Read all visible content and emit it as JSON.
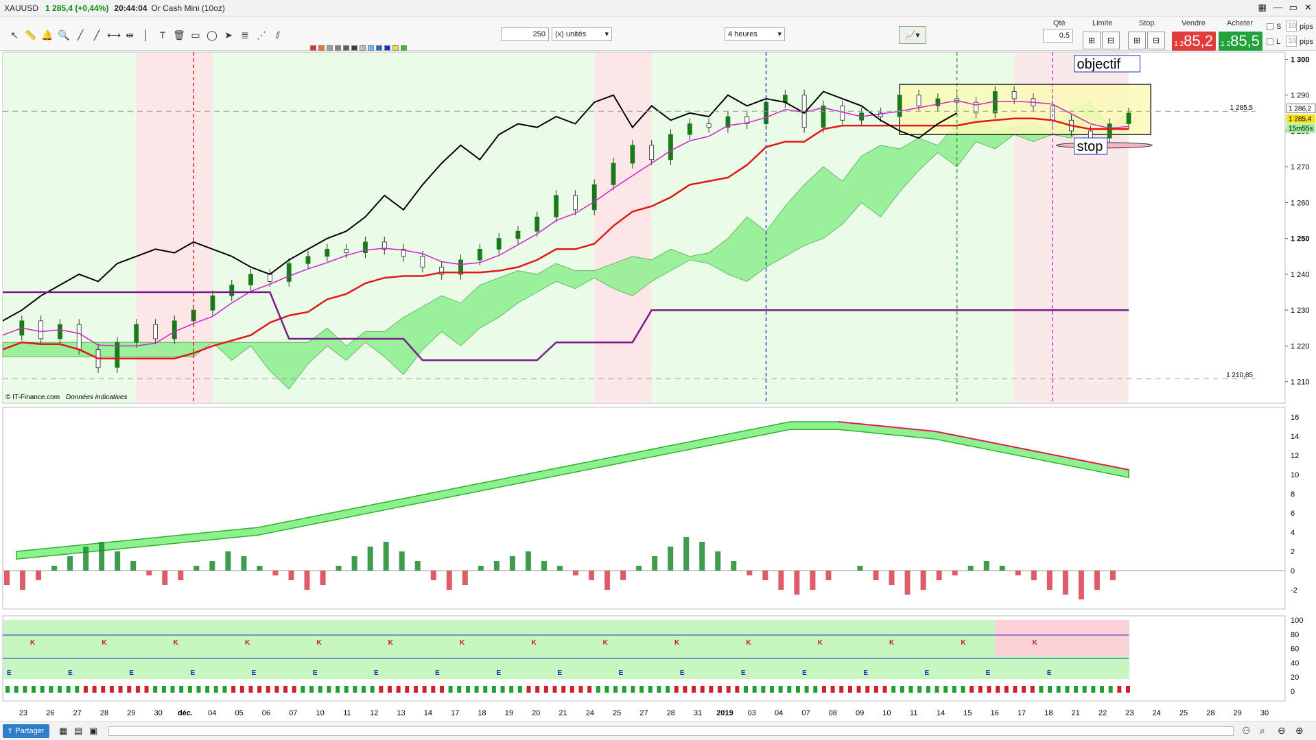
{
  "window": {
    "symbol": "XAUUSD",
    "change": "1 285,4 (+0,44%)",
    "time": "20:44:04",
    "instrument": "Or Cash Mini (10oz)"
  },
  "toolbar": {
    "quantity_value": "250",
    "units_select": "(x) unités",
    "timeframe_select": "4 heures"
  },
  "ticket": {
    "qty_label": "Qté",
    "qty_value": "0.5",
    "limit_label": "Limite",
    "stop_label": "Stop",
    "sell_label": "Vendre",
    "buy_label": "Acheter",
    "sell_price_small": "1 2",
    "sell_price_big": "85,2",
    "buy_price_small": "1 2",
    "buy_price_big": "85,5",
    "s_label": "S",
    "l_label": "L",
    "pips_s": "10",
    "pips_l": "10",
    "pips_unit": "pips"
  },
  "status": {
    "share_label": "Partager",
    "credit": "© IT-Finance.com",
    "credit_note": "Données indicatives"
  },
  "colors": {
    "bull_candle": "#1a7a1a",
    "bear_candle": "#222222",
    "kijun": "#e01818",
    "tenkan": "#1f4fd6",
    "chikou": "#000000",
    "ssb_weekly": "#7a1a8a",
    "kumo_bull": "#8ef08e",
    "kumo_bear": "#f2a0aa",
    "bg_bull": "#eafbe8",
    "bg_bear": "#fde6e8",
    "objective_box": "#fbfbb8"
  },
  "chart_data": [
    {
      "type": "candlestick",
      "title": "",
      "price_axis": {
        "ylim": [
          1204,
          1302
        ],
        "ticks": [
          1300,
          1290,
          1280,
          1270,
          1260,
          1250,
          1240,
          1230,
          1220,
          1210
        ],
        "tick_labels": [
          "1 300",
          "1 290",
          "1 280",
          "1 270",
          "1 260",
          "1 250",
          "1 240",
          "1 230",
          "1 220",
          "1 210"
        ]
      },
      "x_axis_labels": [
        "23",
        "26",
        "27",
        "28",
        "29",
        "30",
        "déc.",
        "04",
        "05",
        "06",
        "07",
        "10",
        "11",
        "12",
        "13",
        "14",
        "17",
        "18",
        "19",
        "20",
        "21",
        "24",
        "25",
        "27",
        "28",
        "31",
        "2019",
        "03",
        "04",
        "07",
        "08",
        "09",
        "10",
        "11",
        "14",
        "15",
        "16",
        "17",
        "18",
        "21",
        "22",
        "23",
        "24",
        "25",
        "28",
        "29",
        "30"
      ],
      "price_markers": {
        "hline_upper": "1 285,5",
        "hline_lower": "1 210,85",
        "last": "1 285,4",
        "ask": "1 286,2",
        "countdown": "15m55s"
      },
      "annotations": [
        {
          "text": "objectif",
          "price": 1298
        },
        {
          "text": "stop",
          "price": 1275
        }
      ],
      "close_path": [
        [
          0,
          1223
        ],
        [
          1,
          1227
        ],
        [
          2,
          1222
        ],
        [
          3,
          1226
        ],
        [
          4,
          1219
        ],
        [
          5,
          1214
        ],
        [
          6,
          1221
        ],
        [
          7,
          1226
        ],
        [
          8,
          1222
        ],
        [
          9,
          1227
        ],
        [
          10,
          1230
        ],
        [
          11,
          1234
        ],
        [
          12,
          1237
        ],
        [
          13,
          1240
        ],
        [
          14,
          1238
        ],
        [
          15,
          1243
        ],
        [
          16,
          1245
        ],
        [
          17,
          1247
        ],
        [
          18,
          1246
        ],
        [
          19,
          1249
        ],
        [
          20,
          1247
        ],
        [
          21,
          1245
        ],
        [
          22,
          1242
        ],
        [
          23,
          1240
        ],
        [
          24,
          1244
        ],
        [
          25,
          1247
        ],
        [
          26,
          1250
        ],
        [
          27,
          1252
        ],
        [
          28,
          1256
        ],
        [
          29,
          1262
        ],
        [
          30,
          1258
        ],
        [
          31,
          1265
        ],
        [
          32,
          1271
        ],
        [
          33,
          1276
        ],
        [
          34,
          1272
        ],
        [
          35,
          1279
        ],
        [
          36,
          1282
        ],
        [
          37,
          1281
        ],
        [
          38,
          1284
        ],
        [
          39,
          1282
        ],
        [
          40,
          1288
        ],
        [
          41,
          1290
        ],
        [
          42,
          1281
        ],
        [
          43,
          1287
        ],
        [
          44,
          1283
        ],
        [
          45,
          1285
        ],
        [
          46,
          1284
        ],
        [
          47,
          1290
        ],
        [
          48,
          1287
        ],
        [
          49,
          1289
        ],
        [
          50,
          1288
        ],
        [
          51,
          1285
        ],
        [
          52,
          1291
        ],
        [
          53,
          1289
        ],
        [
          54,
          1287
        ],
        [
          55,
          1283
        ],
        [
          56,
          1280
        ],
        [
          57,
          1278
        ],
        [
          58,
          1282
        ],
        [
          59,
          1285
        ]
      ]
    },
    {
      "type": "oscillator",
      "title": "",
      "ylim": [
        -4,
        17
      ],
      "ticks": [
        16,
        14,
        12,
        10,
        8,
        6,
        4,
        2,
        0,
        -2
      ],
      "series": [
        {
          "values": [
            2,
            2.5,
            3,
            3.5,
            4,
            4.5,
            5.5,
            6.5,
            7.5,
            8.5,
            9.5,
            10.5,
            11.5,
            12.5,
            13.5,
            14.5,
            15.5,
            15.5,
            15,
            14.5,
            13.5,
            12.5,
            11.5,
            10.5
          ]
        }
      ],
      "histogram_pattern": [
        -1.5,
        -2,
        -1,
        0.5,
        1.5,
        2.5,
        3,
        2,
        1,
        -0.5,
        -1.5,
        -1,
        0.5,
        1,
        2,
        1.5,
        0.5,
        -0.5,
        -1,
        -2,
        -1.5,
        0.5,
        1.5,
        2.5,
        3,
        2,
        1,
        -1,
        -2,
        -1.5,
        0.5,
        1,
        1.5,
        2,
        1,
        0.5,
        -0.5,
        -1,
        -2,
        -1,
        0.5,
        1.5,
        2.5,
        3.5,
        3,
        2,
        1,
        -0.5,
        -1,
        -2,
        -2.5,
        -2,
        -1,
        0,
        0.5,
        -1,
        -1.5,
        -2.5,
        -2,
        -1,
        -0.5,
        0.5,
        1,
        0.5,
        -0.5,
        -1,
        -2,
        -2.5,
        -3,
        -2,
        -1,
        0
      ]
    },
    {
      "type": "signal_panel",
      "title": "",
      "ticks": [
        100,
        80,
        60,
        40,
        20,
        0
      ],
      "letters_row_k": [
        "K",
        "K",
        "K",
        "K",
        "K",
        "K",
        "K",
        "K",
        "K",
        "K",
        "K",
        "K",
        "K",
        "K",
        "K"
      ],
      "letters_row_e": [
        "E",
        "E",
        "E",
        "E",
        "E",
        "E",
        "E",
        "E",
        "E",
        "E",
        "E",
        "E",
        "E",
        "E",
        "E",
        "E",
        "E",
        "E"
      ]
    }
  ]
}
